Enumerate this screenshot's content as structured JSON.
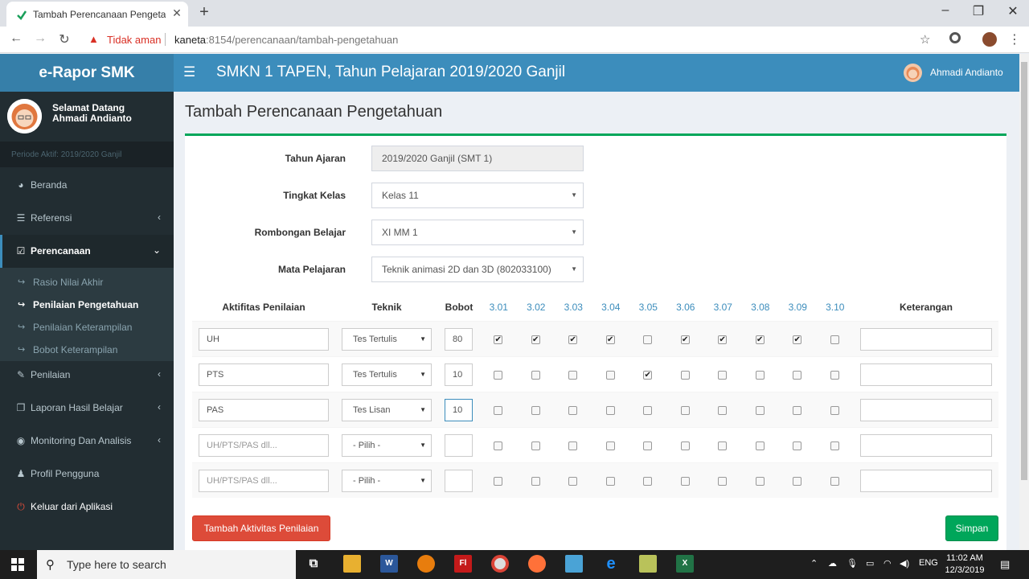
{
  "browser": {
    "tab_title": "Tambah Perencanaan Pengetahuan",
    "tab_close": "✕",
    "new_tab": "+",
    "security_label": "Tidak aman",
    "url_host": "kaneta",
    "url_path": ":8154/perencanaan/tambah-pengetahuan"
  },
  "app": {
    "brand": "e-Rapor SMK",
    "school_title": "SMKN 1 TAPEN, Tahun Pelajaran 2019/2020 Ganjil",
    "user_name": "Ahmadi Andianto"
  },
  "sidebar": {
    "welcome_line1": "Selamat Datang",
    "welcome_line2": "Ahmadi Andianto",
    "periode": "Periode Aktif: 2019/2020 Ganjil",
    "items": [
      {
        "label": "Beranda",
        "icon": "dashboard-icon"
      },
      {
        "label": "Referensi",
        "icon": "list-icon"
      },
      {
        "label": "Perencanaan",
        "icon": "check-square-icon"
      },
      {
        "label": "Penilaian",
        "icon": "edit-icon"
      },
      {
        "label": "Laporan Hasil Belajar",
        "icon": "copy-icon"
      },
      {
        "label": "Monitoring Dan Analisis",
        "icon": "eye-icon"
      },
      {
        "label": "Profil Pengguna",
        "icon": "user-icon"
      },
      {
        "label": "Keluar dari Aplikasi",
        "icon": "power-icon"
      }
    ],
    "submenu": [
      {
        "label": "Rasio Nilai Akhir"
      },
      {
        "label": "Penilaian Pengetahuan"
      },
      {
        "label": "Penilaian Keterampilan"
      },
      {
        "label": "Bobot Keterampilan"
      }
    ]
  },
  "page": {
    "title": "Tambah Perencanaan Pengetahuan",
    "form": {
      "tahun_ajaran_label": "Tahun Ajaran",
      "tahun_ajaran_value": "2019/2020 Ganjil (SMT 1)",
      "tingkat_kelas_label": "Tingkat Kelas",
      "tingkat_kelas_value": "Kelas 11",
      "rombel_label": "Rombongan Belajar",
      "rombel_value": "XI MM 1",
      "mapel_label": "Mata Pelajaran",
      "mapel_value": "Teknik animasi 2D dan 3D (802033100)"
    },
    "table": {
      "headers": {
        "aktivitas": "Aktifitas Penilaian",
        "teknik": "Teknik",
        "bobot": "Bobot",
        "keterangan": "Keterangan"
      },
      "kd": [
        "3.01",
        "3.02",
        "3.03",
        "3.04",
        "3.05",
        "3.06",
        "3.07",
        "3.08",
        "3.09",
        "3.10"
      ],
      "rows": [
        {
          "aktivitas": "UH",
          "teknik": "Tes Tertulis",
          "bobot": "80",
          "checks": [
            true,
            true,
            true,
            true,
            false,
            true,
            true,
            true,
            true,
            false
          ],
          "keterangan": ""
        },
        {
          "aktivitas": "PTS",
          "teknik": "Tes Tertulis",
          "bobot": "10",
          "checks": [
            false,
            false,
            false,
            false,
            true,
            false,
            false,
            false,
            false,
            false
          ],
          "keterangan": ""
        },
        {
          "aktivitas": "PAS",
          "teknik": "Tes Lisan",
          "bobot": "10",
          "checks": [
            false,
            false,
            false,
            false,
            false,
            false,
            false,
            false,
            false,
            false
          ],
          "keterangan": ""
        },
        {
          "aktivitas": "",
          "aktivitas_placeholder": "UH/PTS/PAS dll...",
          "teknik": "- Pilih -",
          "bobot": "",
          "checks": [
            false,
            false,
            false,
            false,
            false,
            false,
            false,
            false,
            false,
            false
          ],
          "keterangan": ""
        },
        {
          "aktivitas": "",
          "aktivitas_placeholder": "UH/PTS/PAS dll...",
          "teknik": "- Pilih -",
          "bobot": "",
          "checks": [
            false,
            false,
            false,
            false,
            false,
            false,
            false,
            false,
            false,
            false
          ],
          "keterangan": ""
        }
      ]
    },
    "add_button": "Tambah Aktivitas Penilaian",
    "save_button": "Simpan"
  },
  "taskbar": {
    "search_placeholder": "Type here to search",
    "language": "ENG",
    "time": "11:02 AM",
    "date": "12/3/2019"
  },
  "colors": {
    "header": "#3c8dbc",
    "brand": "#367fa9",
    "sidebar": "#222d32",
    "success": "#00a65a",
    "danger": "#dd4b39"
  }
}
